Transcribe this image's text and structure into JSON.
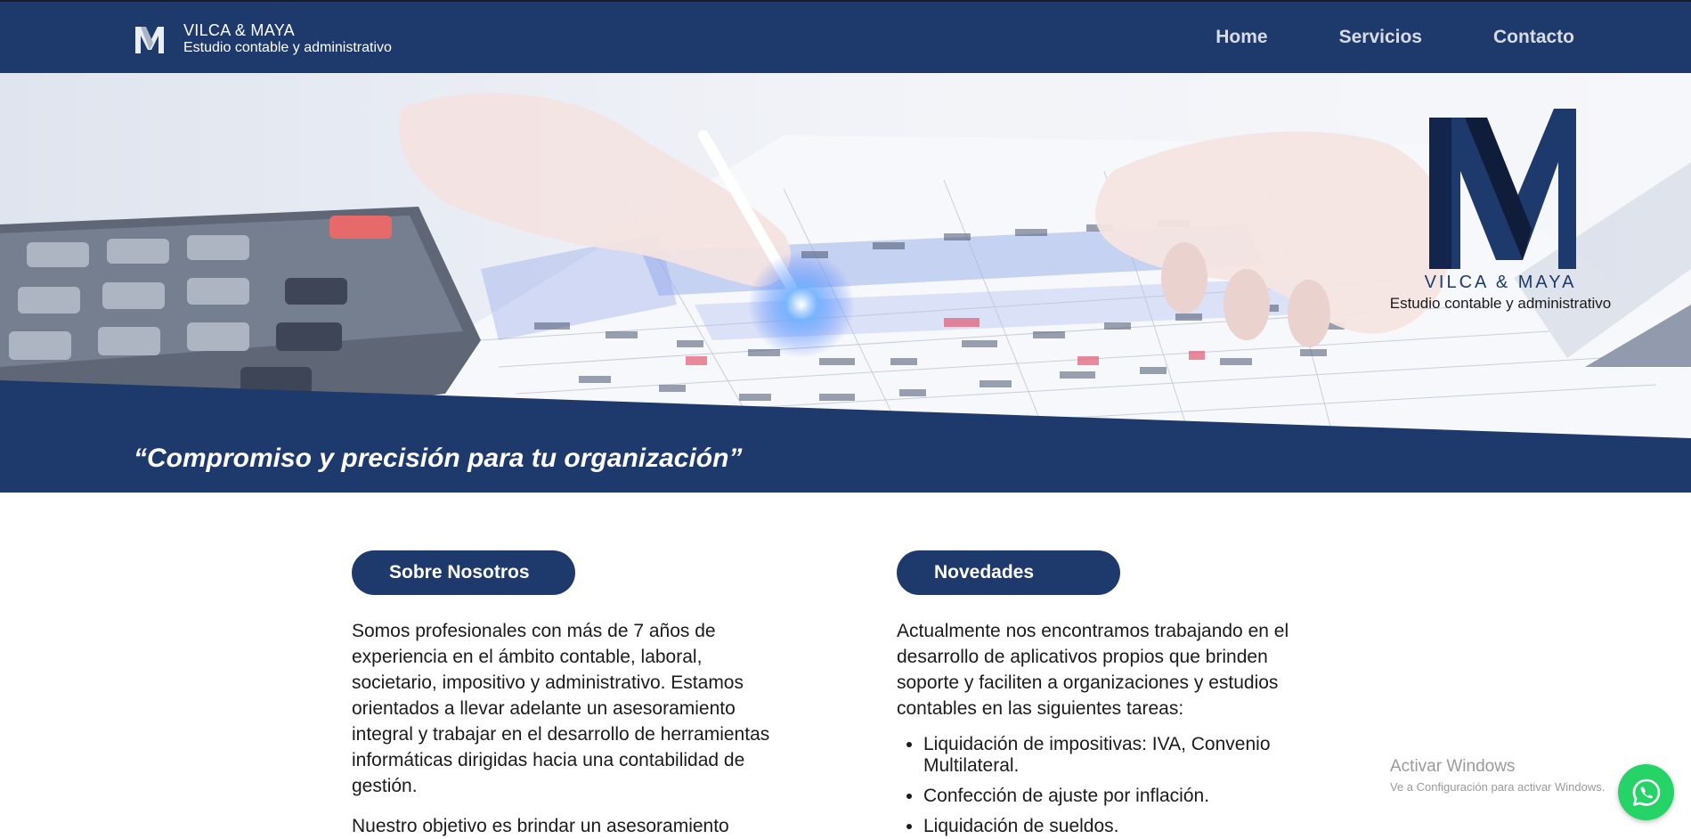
{
  "header": {
    "brand_name": "VILCA & MAYA",
    "brand_sub": "Estudio contable y administrativo",
    "nav": [
      {
        "label": "Home"
      },
      {
        "label": "Servicios"
      },
      {
        "label": "Contacto"
      }
    ]
  },
  "hero": {
    "logo_name": "VILCA & MAYA",
    "logo_sub": "Estudio contable y administrativo",
    "slogan": "“Compromiso y precisión para tu organización”"
  },
  "about": {
    "title": "Sobre Nosotros",
    "paragraph1": "Somos profesionales con más de 7 años de experiencia en el ámbito contable, laboral, societario, impositivo y administrativo. Estamos orientados a llevar adelante un asesoramiento integral y trabajar en el desarrollo de herramientas informáticas dirigidas hacia una contabilidad de gestión.",
    "paragraph2": "Nuestro objetivo es brindar un asesoramiento"
  },
  "news": {
    "title": "Novedades",
    "intro": "Actualmente nos encontramos trabajando en el desarrollo de aplicativos propios que brinden soporte y faciliten a organizaciones y estudios contables en las siguientes tareas:",
    "items": [
      "Liquidación de impositivas: IVA, Convenio Multilateral.",
      "Confección de ajuste por inflación.",
      "Liquidación de sueldos."
    ]
  },
  "watermark": {
    "title": "Activar Windows",
    "sub": "Ve a Configuración para activar Windows."
  },
  "colors": {
    "brand": "#1e3a6d",
    "whatsapp": "#25d366"
  },
  "icons": {
    "brand_logo": "vm-logo-icon",
    "whatsapp": "whatsapp-icon"
  }
}
